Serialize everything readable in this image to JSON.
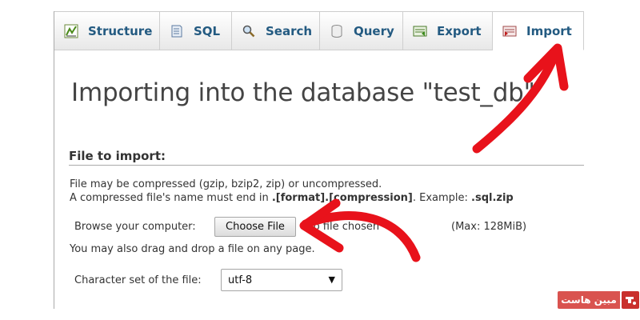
{
  "tabs": [
    {
      "label": "Structure",
      "icon": "structure-icon"
    },
    {
      "label": "SQL",
      "icon": "sql-icon"
    },
    {
      "label": "Search",
      "icon": "search-icon"
    },
    {
      "label": "Query",
      "icon": "query-icon"
    },
    {
      "label": "Export",
      "icon": "export-icon"
    },
    {
      "label": "Import",
      "icon": "import-icon",
      "active": true
    }
  ],
  "main": {
    "heading": "Importing into the database \"test_db\"",
    "section_title": "File to import:",
    "desc_line1": "File may be compressed (gzip, bzip2, zip) or uncompressed.",
    "desc_line2_prefix": "A compressed file's name must end in ",
    "desc_line2_bold": ".[format].[compression]",
    "desc_line2_mid": ". Example: ",
    "desc_line2_example": ".sql.zip",
    "browse_label": "Browse your computer:",
    "choose_file_label": "Choose File",
    "no_file_text": "No file chosen",
    "max_size": "(Max: 128MiB)",
    "drag_note": "You may also drag and drop a file on any page.",
    "charset_label": "Character set of the file:",
    "charset_value": "utf-8"
  },
  "watermark": {
    "text": "مبین هاست",
    "color": "#d9534f"
  },
  "colors": {
    "tab_label": "#235a81",
    "arrow": "#e8121b"
  }
}
